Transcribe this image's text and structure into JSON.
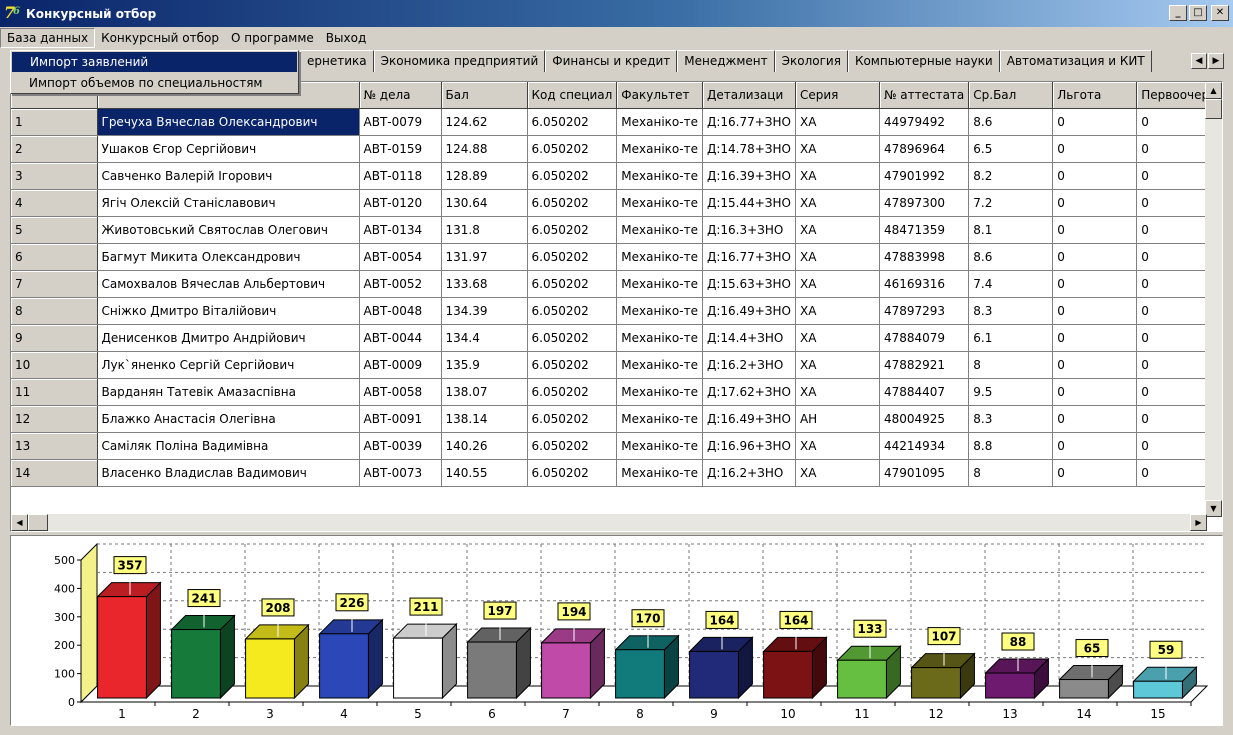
{
  "window": {
    "title": "Конкурсный отбор"
  },
  "menu": [
    "База данных",
    "Конкурсный отбор",
    "О программе",
    "Выход"
  ],
  "dropdown": [
    "Импорт заявлений",
    "Импорт объемов по специальностям"
  ],
  "tabs": [
    "ернетика",
    "Экономика предприятий",
    "Финансы и кредит",
    "Менеджмент",
    "Экология",
    "Компьютерные науки",
    "Автоматизация и КИТ"
  ],
  "table": {
    "columns": [
      "",
      "",
      "№ дела",
      "Бал",
      "Код специал",
      "Факультет",
      "Детализаци",
      "Серия",
      "№ аттестата",
      "Ср.Бал",
      "Льгота",
      "Первоочере"
    ],
    "rows": [
      [
        "1",
        "Гречуха Вячеслав Олександрович",
        "АВТ-0079",
        "124.62",
        "6.050202",
        "Механіко-те",
        "Д:16.77+ЗНО",
        "ХА",
        "44979492",
        "8.6",
        "0",
        "0"
      ],
      [
        "2",
        "Ушаков Єгор Сергійович",
        "АВТ-0159",
        "124.88",
        "6.050202",
        "Механіко-те",
        "Д:14.78+ЗНО",
        "ХА",
        "47896964",
        "6.5",
        "0",
        "0"
      ],
      [
        "3",
        "Савченко Валерій Ігорович",
        "АВТ-0118",
        "128.89",
        "6.050202",
        "Механіко-те",
        "Д:16.39+ЗНО",
        "ХА",
        "47901992",
        "8.2",
        "0",
        "0"
      ],
      [
        "4",
        "Ягіч Олексій Станіславович",
        "АВТ-0120",
        "130.64",
        "6.050202",
        "Механіко-те",
        "Д:15.44+ЗНО",
        "ХА",
        "47897300",
        "7.2",
        "0",
        "0"
      ],
      [
        "5",
        "Животовський Святослав Олегович",
        "АВТ-0134",
        "131.8",
        "6.050202",
        "Механіко-те",
        "Д:16.3+ЗНО",
        "ХА",
        "48471359",
        "8.1",
        "0",
        "0"
      ],
      [
        "6",
        "Багмут Микита Олександрович",
        "АВТ-0054",
        "131.97",
        "6.050202",
        "Механіко-те",
        "Д:16.77+ЗНО",
        "ХА",
        "47883998",
        "8.6",
        "0",
        "0"
      ],
      [
        "7",
        "Самохвалов Вячеслав Альбертович",
        "АВТ-0052",
        "133.68",
        "6.050202",
        "Механіко-те",
        "Д:15.63+ЗНО",
        "ХА",
        "46169316",
        "7.4",
        "0",
        "0"
      ],
      [
        "8",
        "Сніжко Дмитро Віталійович",
        "АВТ-0048",
        "134.39",
        "6.050202",
        "Механіко-те",
        "Д:16.49+ЗНО",
        "ХА",
        "47897293",
        "8.3",
        "0",
        "0"
      ],
      [
        "9",
        "Денисенков Дмитро Андрійович",
        "АВТ-0044",
        "134.4",
        "6.050202",
        "Механіко-те",
        "Д:14.4+ЗНО",
        "ХА",
        "47884079",
        "6.1",
        "0",
        "0"
      ],
      [
        "10",
        "Лук`яненко Сергій Сергійович",
        "АВТ-0009",
        "135.9",
        "6.050202",
        "Механіко-те",
        "Д:16.2+ЗНО",
        "ХА",
        "47882921",
        "8",
        "0",
        "0"
      ],
      [
        "11",
        "Варданян Татевік Амазаспівна",
        "АВТ-0058",
        "138.07",
        "6.050202",
        "Механіко-те",
        "Д:17.62+ЗНО",
        "ХА",
        "47884407",
        "9.5",
        "0",
        "0"
      ],
      [
        "12",
        "Блажко Анастасія Олегівна",
        "АВТ-0091",
        "138.14",
        "6.050202",
        "Механіко-те",
        "Д:16.49+ЗНО",
        "АН",
        "48004925",
        "8.3",
        "0",
        "0"
      ],
      [
        "13",
        "Саміляк Поліна Вадимівна",
        "АВТ-0039",
        "140.26",
        "6.050202",
        "Механіко-те",
        "Д:16.96+ЗНО",
        "ХА",
        "44214934",
        "8.8",
        "0",
        "0"
      ],
      [
        "14",
        "Власенко Владислав Вадимович",
        "АВТ-0073",
        "140.55",
        "6.050202",
        "Механіко-те",
        "Д:16.2+ЗНО",
        "ХА",
        "47901095",
        "8",
        "0",
        "0"
      ]
    ]
  },
  "chart_data": {
    "type": "bar",
    "categories": [
      "1",
      "2",
      "3",
      "4",
      "5",
      "6",
      "7",
      "8",
      "9",
      "10",
      "11",
      "12",
      "13",
      "14",
      "15"
    ],
    "values": [
      357,
      241,
      208,
      226,
      211,
      197,
      194,
      170,
      164,
      164,
      133,
      107,
      88,
      65,
      59
    ],
    "colors": [
      "#e8262b",
      "#157a3a",
      "#f4ea1d",
      "#2c47b8",
      "#ffffff",
      "#7a7a7a",
      "#c04aa8",
      "#117a7a",
      "#202a78",
      "#7c1214",
      "#66bf40",
      "#6b6a1a",
      "#6e1a6e",
      "#8a8a8a",
      "#5cc8d8"
    ],
    "yticks": [
      "0",
      "100",
      "200",
      "300",
      "400",
      "500"
    ],
    "ylim": [
      0,
      500
    ],
    "grid": true,
    "three_d": true,
    "label_color": "#ffff80"
  }
}
